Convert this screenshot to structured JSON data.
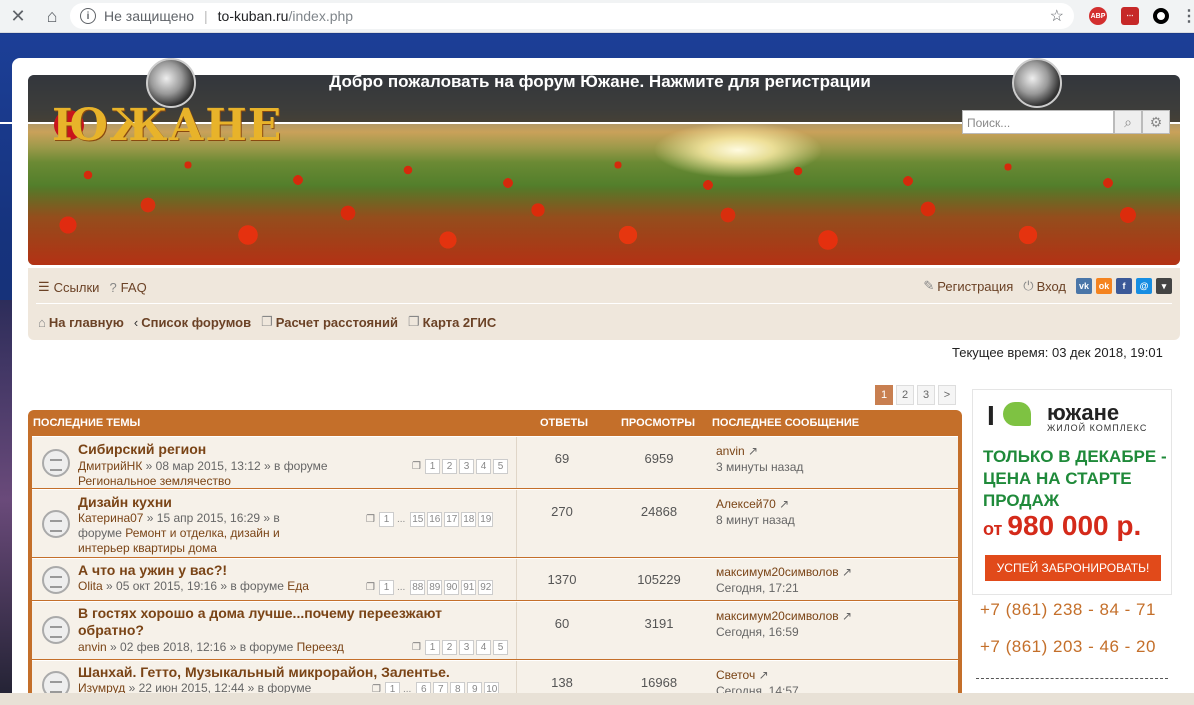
{
  "browser": {
    "info_icon": "i",
    "insecure": "Не защищено",
    "host": "to-kuban.ru",
    "path": "/index.php",
    "ext_abp": "ABP"
  },
  "header": {
    "welcome": "Добро пожаловать на форум Южане. Нажмите для регистрации",
    "logo": "ЮЖАНЕ",
    "search_placeholder": "Поиск..."
  },
  "nav": {
    "links": "Ссылки",
    "faq": "FAQ",
    "register": "Регистрация",
    "login": "Вход",
    "social": [
      "vk",
      "ok",
      "f",
      "@",
      "▾"
    ],
    "breadcrumbs": [
      {
        "label": "На главную"
      },
      {
        "label": "Список форумов"
      },
      {
        "label": "Расчет расстояний"
      },
      {
        "label": "Карта 2ГИС"
      }
    ]
  },
  "current_time": "Текущее время: 03 дек 2018, 19:01",
  "pager": [
    "1",
    "2",
    "3",
    ">"
  ],
  "table": {
    "headers": {
      "topics": "ПОСЛЕДНИЕ ТЕМЫ",
      "replies": "ОТВЕТЫ",
      "views": "ПРОСМОТРЫ",
      "last": "ПОСЛЕДНЕЕ СООБЩЕНИЕ"
    },
    "rows": [
      {
        "title": "Сибирский регион",
        "author": "ДмитрийНК",
        "meta": " » 08 мар 2015, 13:12 » в форуме",
        "forum": "Региональное землячество",
        "pages": [
          "1",
          "2",
          "3",
          "4",
          "5"
        ],
        "replies": "69",
        "views": "6959",
        "last_user": "anvin",
        "last_time": "3 минуты назад"
      },
      {
        "title": "Дизайн кухни",
        "author": "Катерина07",
        "meta": " » 15 апр 2015, 16:29 » в",
        "meta2": "форуме",
        "forum": "Ремонт и отделка, дизайн и интерьер квартиры дома",
        "pages": [
          "1",
          "...",
          "15",
          "16",
          "17",
          "18",
          "19"
        ],
        "replies": "270",
        "views": "24868",
        "last_user": "Алексей70",
        "last_time": "8 минут назад"
      },
      {
        "title": "А что на ужин у вас?!",
        "author": "Olita",
        "meta": " » 05 окт 2015, 19:16 » в форуме",
        "forum": "Еда",
        "pages": [
          "1",
          "...",
          "88",
          "89",
          "90",
          "91",
          "92"
        ],
        "replies": "1370",
        "views": "105229",
        "last_user": "максимум20символов",
        "last_time": "Сегодня, 17:21"
      },
      {
        "title": "В гостях хорошо а дома лучше...почему переезжают обратно?",
        "author": "anvin",
        "meta": " » 02 фев 2018, 12:16 » в форуме",
        "forum": "Переезд",
        "pages": [
          "1",
          "2",
          "3",
          "4",
          "5"
        ],
        "replies": "60",
        "views": "3191",
        "last_user": "максимум20символов",
        "last_time": "Сегодня, 16:59"
      },
      {
        "title": "Шанхай. Гетто, Музыкальный микрорайон, Залентье.",
        "author": "Изумруд",
        "meta": " » 22 июн 2015, 12:44 » в форуме",
        "pages": [
          "1",
          "...",
          "6",
          "7",
          "8",
          "9",
          "10"
        ],
        "replies": "138",
        "views": "16968",
        "last_user": "Светоч",
        "last_time": "Сегодня, 14:57"
      }
    ]
  },
  "ad": {
    "heart": "I",
    "brand": "южане",
    "sub": "ЖИЛОЙ КОМПЛЕКС",
    "promo1": "ТОЛЬКО В ДЕКАБРЕ -",
    "promo2": "ЦЕНА НА СТАРТЕ",
    "promo3": "ПРОДАЖ",
    "price_prefix": "от ",
    "price": "980 000 р.",
    "cta": "УСПЕЙ ЗАБРОНИРОВАТЬ!",
    "phone1": "+7 (861) 238 - 84 - 71",
    "phone2": "+7 (861) 203 - 46 - 20"
  }
}
